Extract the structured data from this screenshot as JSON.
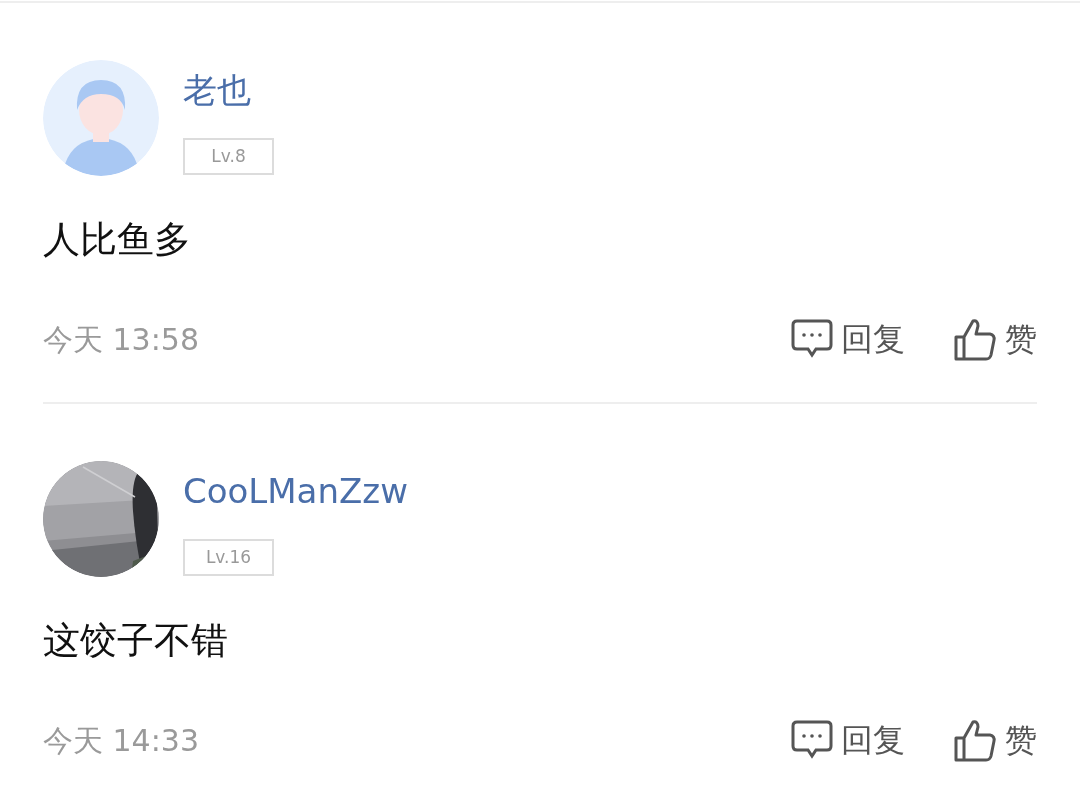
{
  "comments": [
    {
      "avatar": {
        "kind": "default"
      },
      "username": "老也",
      "level": "Lv.8",
      "text": "人比鱼多",
      "time": "今天 13:58",
      "actions": {
        "reply": "回复",
        "like": "赞"
      }
    },
    {
      "username": "CooLManZzw",
      "level": "Lv.16",
      "text": "这饺子不错",
      "time": "今天 14:33",
      "actions": {
        "reply": "回复",
        "like": "赞"
      }
    }
  ]
}
